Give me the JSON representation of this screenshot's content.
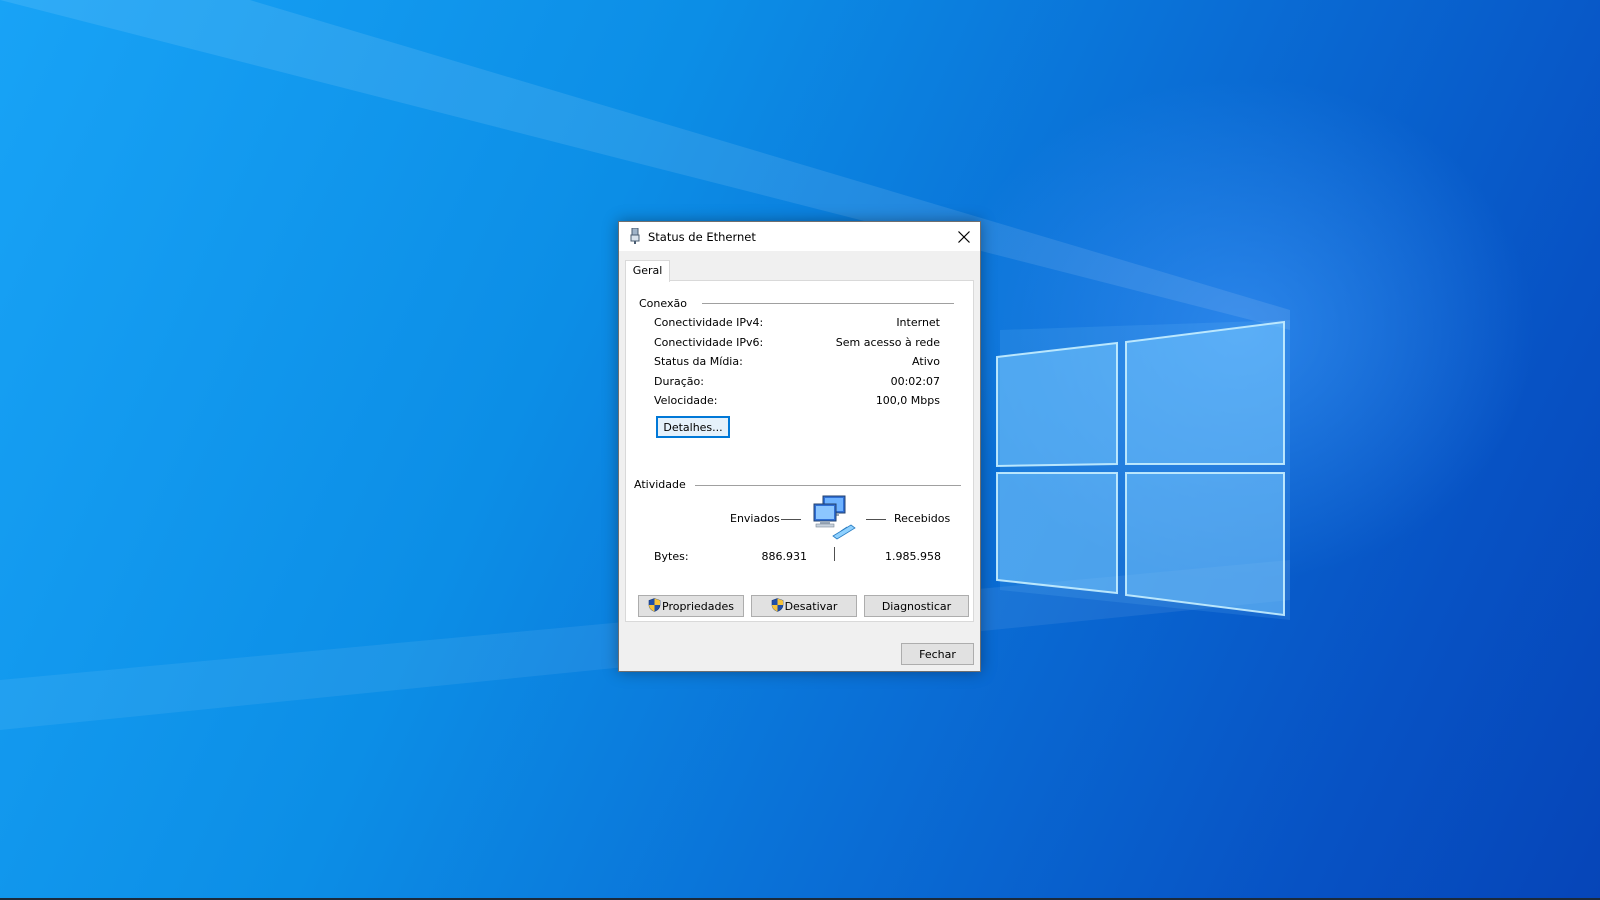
{
  "window": {
    "title": "Status de Ethernet",
    "tab_label": "Geral"
  },
  "connection": {
    "group_label": "Conexão",
    "rows": [
      {
        "label": "Conectividade IPv4:",
        "value": "Internet"
      },
      {
        "label": "Conectividade IPv6:",
        "value": "Sem acesso à rede"
      },
      {
        "label": "Status da Mídia:",
        "value": "Ativo"
      },
      {
        "label": "Duração:",
        "value": "00:02:07"
      },
      {
        "label": "Velocidade:",
        "value": "100,0 Mbps"
      }
    ],
    "details_button": "Detalhes..."
  },
  "activity": {
    "group_label": "Atividade",
    "sent_label": "Enviados",
    "received_label": "Recebidos",
    "bytes_label": "Bytes:",
    "bytes_sent": "886.931",
    "bytes_received": "1.985.958"
  },
  "buttons": {
    "properties": "Propriedades",
    "disable": "Desativar",
    "diagnose": "Diagnosticar",
    "close": "Fechar"
  },
  "icons": {
    "title": "ethernet-plug-icon",
    "close": "close-icon",
    "network": "network-computers-icon",
    "shield": "uac-shield-icon"
  },
  "colors": {
    "desktop_light": "#18a3f6",
    "desktop_dark": "#0645b8",
    "focus_border": "#0078d7"
  }
}
